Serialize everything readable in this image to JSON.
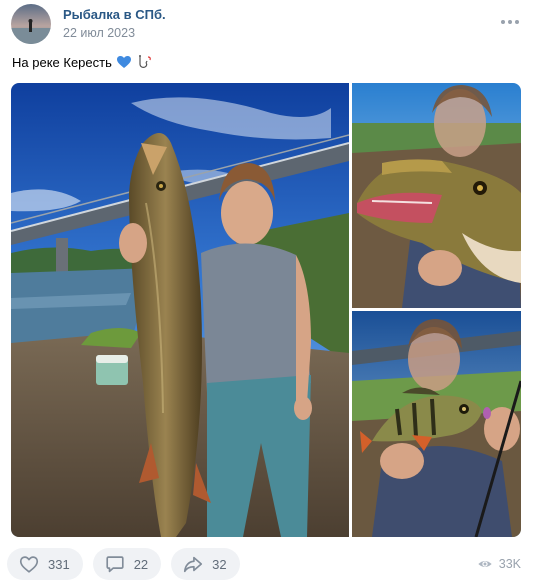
{
  "post": {
    "author": "Рыбалка в СПб.",
    "date": "22 июл 2023",
    "text": "На реке Кересть"
  },
  "actions": {
    "likes": "331",
    "comments": "22",
    "shares": "32",
    "views": "33K"
  },
  "icons": {
    "like": "heart-icon",
    "comment": "comment-icon",
    "share": "share-arrow-icon",
    "views": "eye-icon",
    "more": "more-dots-icon"
  },
  "colors": {
    "author_link": "#2a5885",
    "muted": "#818c99",
    "button_bg": "#f0f2f5",
    "blue_heart": "#3f8ae0"
  }
}
